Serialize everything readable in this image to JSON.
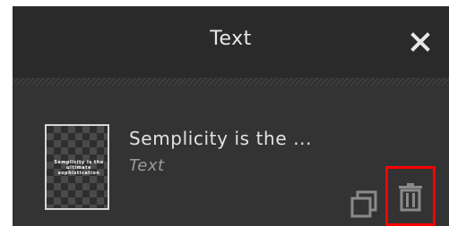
{
  "header": {
    "title": "Text"
  },
  "layer": {
    "name": "Semplicity is the ...",
    "type": "Text",
    "thumbnail_text": "Semplicity is the ultimate sophistication"
  },
  "icons": {
    "close": "close-icon",
    "duplicate": "duplicate-icon",
    "delete": "trash-icon"
  },
  "colors": {
    "panel_background": "#333333",
    "header_background": "#2a2a2a",
    "highlight": "#ff0000"
  }
}
